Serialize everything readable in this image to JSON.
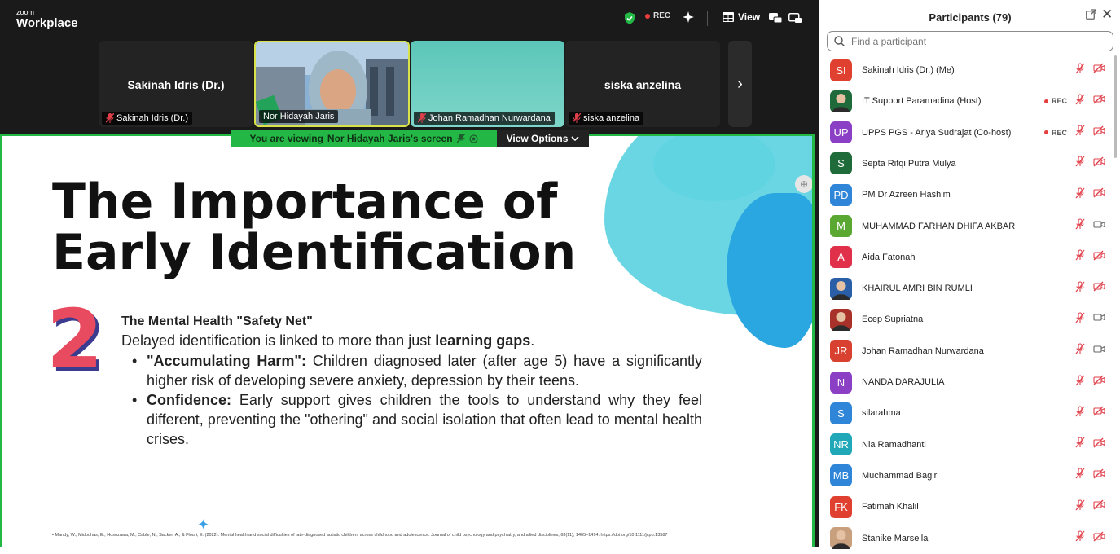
{
  "app": {
    "brand_top": "zoom",
    "brand_bottom": "Workplace",
    "rec_label": "REC",
    "view_label": "View"
  },
  "gallery": {
    "tiles": [
      {
        "name": "Sakinah Idris (Dr.)",
        "label": "Sakinah Idris (Dr.)",
        "muted": true,
        "has_video": false
      },
      {
        "name": "",
        "label": "Nor Hidayah Jaris",
        "muted": false,
        "has_video": true
      },
      {
        "name": "",
        "label": "Johan Ramadhan Nurwardana",
        "muted": true,
        "has_video": true
      },
      {
        "name": "siska anzelina",
        "label": "siska anzelina",
        "muted": true,
        "has_video": false
      }
    ],
    "next_arrow": "›"
  },
  "share_bar": {
    "prefix": "You are viewing",
    "presenter": "Nor Hidayah Jaris's screen",
    "view_options": "View Options"
  },
  "slide": {
    "title_line1": "The Importance of",
    "title_line2": "Early Identification",
    "number": "2",
    "point_title": "The Mental Health \"Safety Net\"",
    "lead_text": "Delayed identification is linked to more than just ",
    "lead_bold": "learning gaps",
    "lead_end": ".",
    "bullets": [
      {
        "bold": "\"Accumulating Harm\":",
        "text": " Children diagnosed later (after age 5) have a significantly higher risk of developing severe anxiety, depression by their teens."
      },
      {
        "bold": "Confidence:",
        "text": " Early support gives children the tools to understand why they feel different, preventing the \"othering\" and social isolation that often lead to mental health crises."
      }
    ],
    "citation": "• Mandy, W., Midouhas, E., Hosozawa, M., Cable, N., Sacker, A., & Flouri, E. (2022). Mental health and social difficulties of late-diagnosed autistic children, across childhood and adolescence. Journal of child psychology and psychiatry, and allied disciplines, 63(11), 1405–1414. https://doi.org/10.1111/jcpp.13587"
  },
  "panel": {
    "title": "Participants (79)",
    "search_placeholder": "Find a participant",
    "participants": [
      {
        "initials": "SI",
        "color": "#e0402f",
        "name": "Sakinah Idris (Dr.) (Me)",
        "rec": false,
        "mic_muted": true,
        "cam_off": true,
        "photo": false
      },
      {
        "initials": "",
        "color": "#1e6a3a",
        "name": "IT Support Paramadina (Host)",
        "rec": true,
        "mic_muted": true,
        "cam_off": true,
        "photo": true
      },
      {
        "initials": "UP",
        "color": "#8a3fc4",
        "name": "UPPS PGS - Ariya Sudrajat (Co-host)",
        "rec": true,
        "mic_muted": true,
        "cam_off": true,
        "photo": false
      },
      {
        "initials": "S",
        "color": "#1f6b3a",
        "name": "Septa Rifqi Putra Mulya",
        "rec": false,
        "mic_muted": true,
        "cam_off": true,
        "photo": false
      },
      {
        "initials": "PD",
        "color": "#2f86d8",
        "name": "PM Dr Azreen Hashim",
        "rec": false,
        "mic_muted": true,
        "cam_off": true,
        "photo": false
      },
      {
        "initials": "M",
        "color": "#5aa832",
        "name": "MUHAMMAD FARHAN DHIFA AKBAR",
        "rec": false,
        "mic_muted": true,
        "cam_off": false,
        "photo": false
      },
      {
        "initials": "A",
        "color": "#e0304a",
        "name": "Aida Fatonah",
        "rec": false,
        "mic_muted": true,
        "cam_off": true,
        "photo": false
      },
      {
        "initials": "",
        "color": "#2a5fa8",
        "name": "KHAIRUL AMRI BIN RUMLI",
        "rec": false,
        "mic_muted": true,
        "cam_off": true,
        "photo": true
      },
      {
        "initials": "",
        "color": "#a8322a",
        "name": "Ecep Supriatna",
        "rec": false,
        "mic_muted": true,
        "cam_off": false,
        "photo": true
      },
      {
        "initials": "JR",
        "color": "#d8402f",
        "name": "Johan Ramadhan Nurwardana",
        "rec": false,
        "mic_muted": true,
        "cam_off": false,
        "photo": false
      },
      {
        "initials": "N",
        "color": "#8a3fc4",
        "name": "NANDA DARAJULIA",
        "rec": false,
        "mic_muted": true,
        "cam_off": true,
        "photo": false
      },
      {
        "initials": "S",
        "color": "#2f86d8",
        "name": "silarahma",
        "rec": false,
        "mic_muted": true,
        "cam_off": true,
        "photo": false
      },
      {
        "initials": "NR",
        "color": "#20a8b8",
        "name": "Nia Ramadhanti",
        "rec": false,
        "mic_muted": true,
        "cam_off": true,
        "photo": false
      },
      {
        "initials": "MB",
        "color": "#2f86d8",
        "name": "Muchammad Bagir",
        "rec": false,
        "mic_muted": true,
        "cam_off": true,
        "photo": false
      },
      {
        "initials": "FK",
        "color": "#e0402f",
        "name": "Fatimah Khalil",
        "rec": false,
        "mic_muted": true,
        "cam_off": true,
        "photo": false
      },
      {
        "initials": "",
        "color": "#c9a07e",
        "name": "Stanike Marsella",
        "rec": false,
        "mic_muted": true,
        "cam_off": true,
        "photo": true
      }
    ]
  },
  "colors": {
    "share_green": "#23b846",
    "muted_red": "#e0404a",
    "rec_red": "#e83d3d"
  }
}
